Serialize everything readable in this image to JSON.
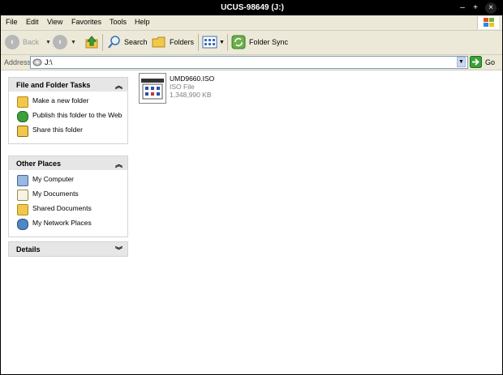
{
  "window": {
    "title": "UCUS-98649 (J:)"
  },
  "titlebar_buttons": {
    "minimize": "–",
    "maximize": "+",
    "close": "×"
  },
  "menu": [
    "File",
    "Edit",
    "View",
    "Favorites",
    "Tools",
    "Help"
  ],
  "toolbar": {
    "back": "Back",
    "search": "Search",
    "folders": "Folders",
    "folder_sync": "Folder Sync"
  },
  "address": {
    "label": "Address",
    "value": "J:\\",
    "go": "Go"
  },
  "tasks": {
    "title": "File and Folder Tasks",
    "items": [
      "Make a new folder",
      "Publish this folder to the Web",
      "Share this folder"
    ]
  },
  "other_places": {
    "title": "Other Places",
    "items": [
      "My Computer",
      "My Documents",
      "Shared Documents",
      "My Network Places"
    ]
  },
  "details": {
    "title": "Details"
  },
  "file": {
    "name": "UMD9660.ISO",
    "type": "ISO File",
    "size": "1,348,990 KB"
  },
  "colors": {
    "accent": "#ece9d8",
    "title_bg": "#000000"
  }
}
